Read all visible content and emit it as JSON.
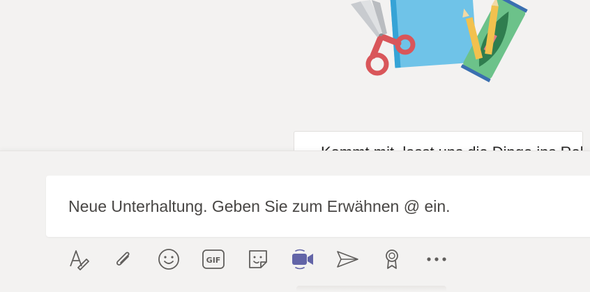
{
  "illustration": {
    "icon": "school-supplies-illustration"
  },
  "message_card": {
    "text": "Kommt mit, lasst uns die Dinge ins Rollen bringen"
  },
  "compose": {
    "placeholder": "Neue Unterhaltung. Geben Sie zum Erwähnen @ ein."
  },
  "toolbar": {
    "gif_label": "GIF",
    "items": [
      {
        "name": "format",
        "icon": "format-icon"
      },
      {
        "name": "attach",
        "icon": "paperclip-icon"
      },
      {
        "name": "emoji",
        "icon": "emoji-icon"
      },
      {
        "name": "gif",
        "icon": "gif-icon"
      },
      {
        "name": "sticker",
        "icon": "sticker-icon"
      },
      {
        "name": "meet-now",
        "icon": "video-camera-icon"
      },
      {
        "name": "stream",
        "icon": "send-arrow-icon"
      },
      {
        "name": "praise",
        "icon": "award-ribbon-icon"
      },
      {
        "name": "more",
        "icon": "more-options-icon"
      }
    ]
  },
  "colors": {
    "background": "#f3f2f1",
    "accent": "#6264a7",
    "icon": "#605e5c"
  }
}
